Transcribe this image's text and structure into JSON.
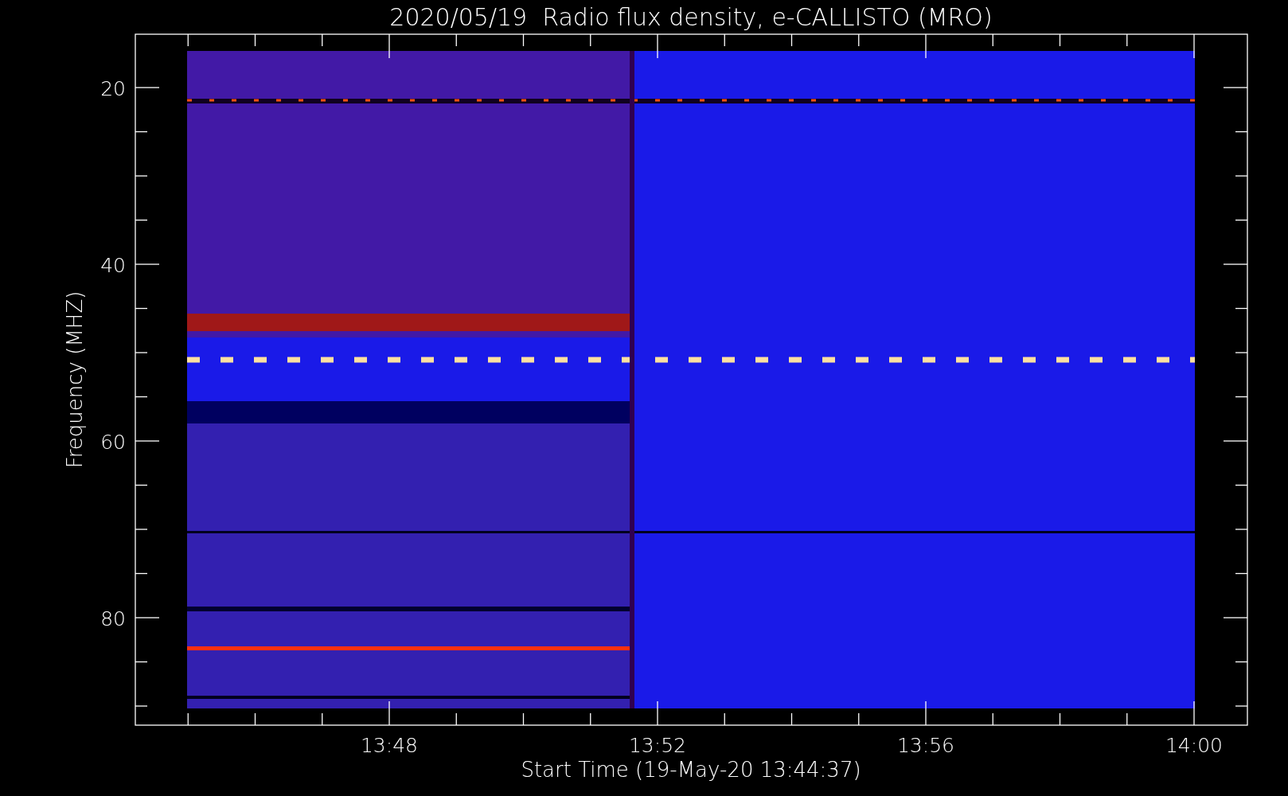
{
  "title": "2020/05/19  Radio flux density, e-CALLISTO (MRO)",
  "y_axis": {
    "label": "Frequency (MHZ)",
    "ticks": [
      "20",
      "40",
      "60",
      "80"
    ]
  },
  "x_axis": {
    "label": "Start Time (19-May-20 13:44:37)",
    "ticks": [
      "13:48",
      "13:52",
      "13:56",
      "14:00"
    ]
  }
}
